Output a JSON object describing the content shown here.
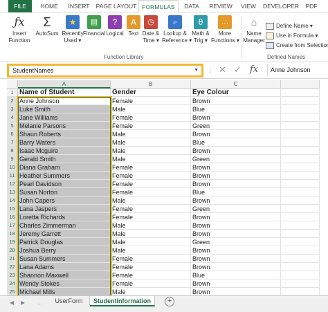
{
  "ribbon_tabs": [
    "FILE",
    "HOME",
    "INSERT",
    "PAGE LAYOUT",
    "FORMULAS",
    "DATA",
    "REVIEW",
    "VIEW",
    "DEVELOPER",
    "PDF"
  ],
  "active_tab": "FORMULAS",
  "colors": {
    "accent": "#217346",
    "highlight": "#f2b632",
    "selection": "#c6c6c6"
  },
  "ribbon": {
    "insert_function": {
      "line1": "Insert",
      "line2": "Function",
      "icon": "fx-icon"
    },
    "autosum": {
      "line1": "AutoSum",
      "icon": "sigma-icon"
    },
    "recently_used": {
      "line1": "Recently",
      "line2": "Used ▾",
      "icon": "star-book-icon"
    },
    "financial": {
      "line1": "Financial",
      "icon": "book-icon"
    },
    "logical": {
      "line1": "Logical",
      "icon": "question-book-icon"
    },
    "text": {
      "line1": "Text",
      "icon": "text-book-icon"
    },
    "date_time": {
      "line1": "Date &",
      "line2": "Time ▾",
      "icon": "calendar-book-icon"
    },
    "lookup_reference": {
      "line1": "Lookup &",
      "line2": "Reference ▾",
      "icon": "lookup-book-icon"
    },
    "math_trig": {
      "line1": "Math &",
      "line2": "Trig ▾",
      "icon": "theta-book-icon"
    },
    "more_functions": {
      "line1": "More",
      "line2": "Functions ▾",
      "icon": "more-book-icon"
    },
    "function_library_label": "Function Library",
    "name_manager": {
      "line1": "Name",
      "line2": "Manager",
      "icon": "name-tag-icon"
    },
    "define_name": "Define Name ▾",
    "use_in_formula": "Use in Formula ▾",
    "create_from_selection": "Create from Selection",
    "defined_names_label": "Defined Names"
  },
  "formula_bar": {
    "name_box": "StudentNames",
    "content": "Anne Johnson",
    "fx": "fx"
  },
  "columns": [
    "A",
    "B",
    "C"
  ],
  "rows": [
    {
      "n": "1",
      "a": "Name of Student",
      "b": "Gender",
      "c": "Eye Colour"
    },
    {
      "n": "2",
      "a": "Anne Johnson",
      "b": "Female",
      "c": "Brown"
    },
    {
      "n": "3",
      "a": "Luke Smith",
      "b": "Male",
      "c": "Blue"
    },
    {
      "n": "4",
      "a": "Jane Williams",
      "b": "Female",
      "c": "Brown"
    },
    {
      "n": "5",
      "a": "Melanie Parsons",
      "b": "Female",
      "c": "Green"
    },
    {
      "n": "6",
      "a": "Shaun Roberts",
      "b": "Male",
      "c": "Brown"
    },
    {
      "n": "7",
      "a": "Barry Waters",
      "b": "Male",
      "c": "Blue"
    },
    {
      "n": "8",
      "a": "Isaac Mcguire",
      "b": "Male",
      "c": "Brown"
    },
    {
      "n": "9",
      "a": "Gerald Smith",
      "b": "Male",
      "c": "Green"
    },
    {
      "n": "10",
      "a": "Diana Graham",
      "b": "Female",
      "c": "Brown"
    },
    {
      "n": "11",
      "a": "Heather Summers",
      "b": "Female",
      "c": "Brown"
    },
    {
      "n": "12",
      "a": "Pearl Davidson",
      "b": "Female",
      "c": "Brown"
    },
    {
      "n": "13",
      "a": "Susan Norton",
      "b": "Female",
      "c": "Blue"
    },
    {
      "n": "14",
      "a": "John Capers",
      "b": "Male",
      "c": "Brown"
    },
    {
      "n": "15",
      "a": "Lana Jaspers",
      "b": "Female",
      "c": "Green"
    },
    {
      "n": "16",
      "a": "Loretta Richards",
      "b": "Female",
      "c": "Brown"
    },
    {
      "n": "17",
      "a": "Charles Zimmerman",
      "b": "Male",
      "c": "Brown"
    },
    {
      "n": "18",
      "a": "Jeremy Garrett",
      "b": "Male",
      "c": "Brown"
    },
    {
      "n": "19",
      "a": "Patrick Douglas",
      "b": "Male",
      "c": "Green"
    },
    {
      "n": "20",
      "a": "Joshua Berry",
      "b": "Male",
      "c": "Brown"
    },
    {
      "n": "21",
      "a": "Susan Summers",
      "b": "Female",
      "c": "Brown"
    },
    {
      "n": "22",
      "a": "Lana Adams",
      "b": "Female",
      "c": "Brown"
    },
    {
      "n": "23",
      "a": "Shannon Maxwell",
      "b": "Female",
      "c": "Blue"
    },
    {
      "n": "24",
      "a": "Wendy Stokes",
      "b": "Female",
      "c": "Brown"
    },
    {
      "n": "25",
      "a": "Michael Mills",
      "b": "Male",
      "c": "Brown"
    }
  ],
  "sheet_tabs": [
    "UserForm",
    "StudentInformation"
  ],
  "active_sheet": "StudentInformation",
  "add_sheet": "+",
  "nav_prev": "◀",
  "nav_next": "▶",
  "more_sheets": "..."
}
